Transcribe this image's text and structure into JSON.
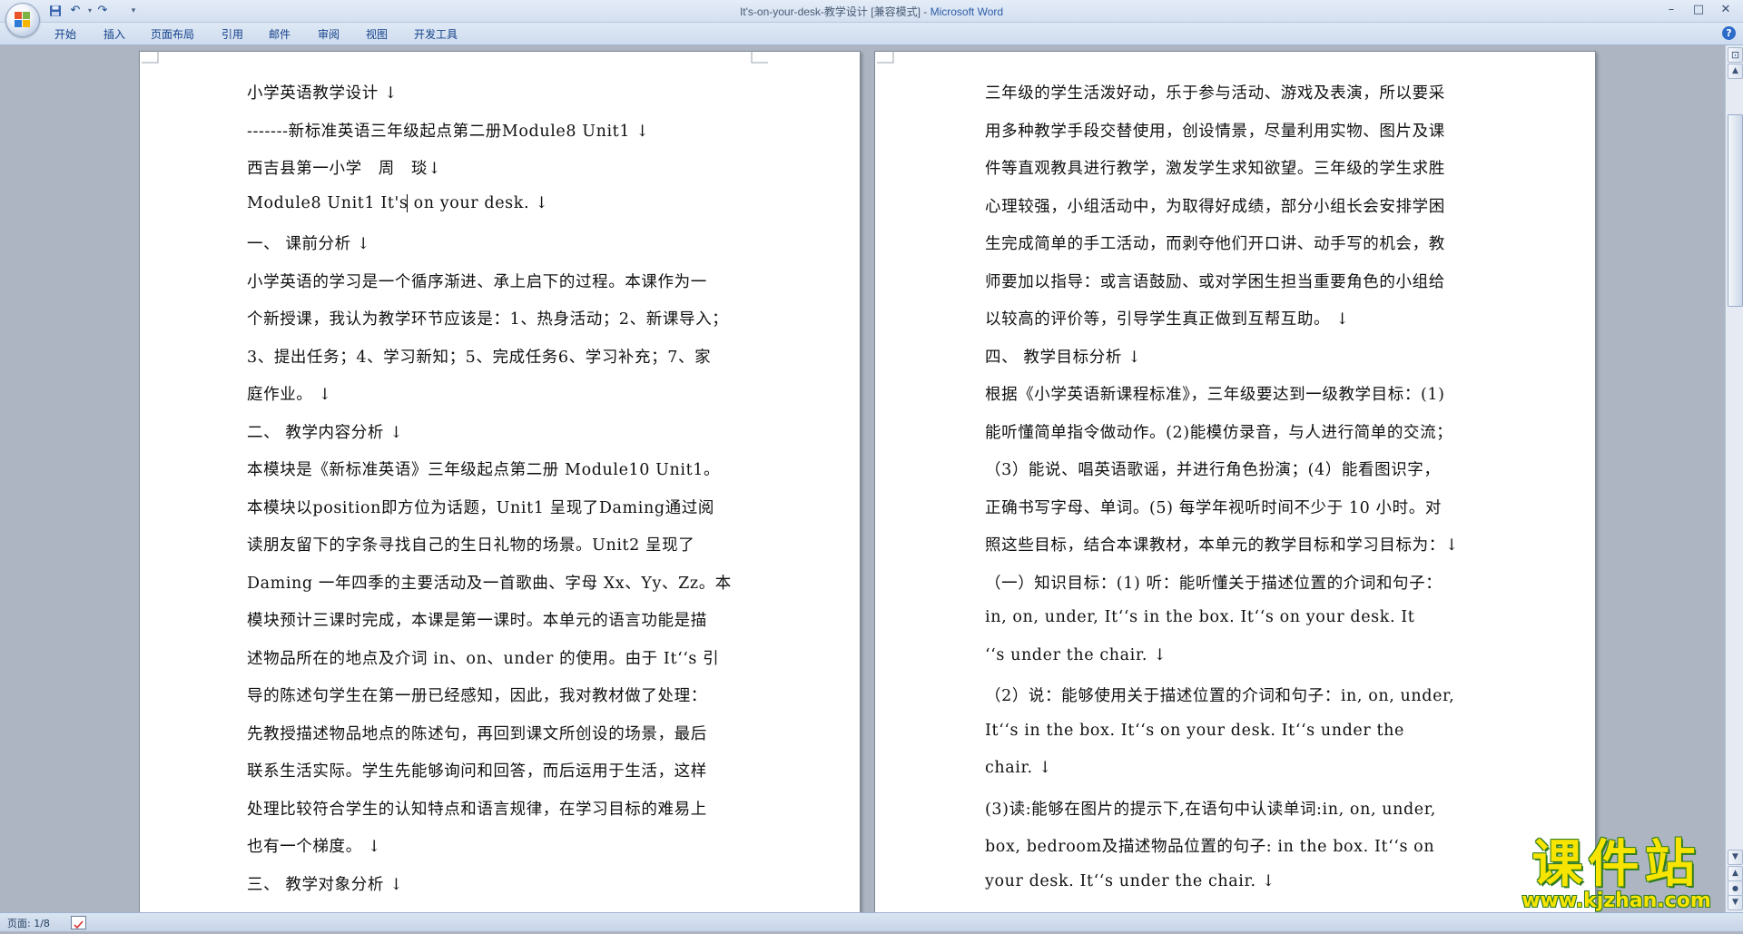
{
  "window": {
    "title_doc": "It's-on-your-desk-教学设计 [兼容模式] - ",
    "title_app": "Microsoft Word"
  },
  "quick_access": {
    "icons": [
      "save-icon",
      "undo-icon",
      "redo-icon",
      "customize-icon"
    ],
    "undo_glyph": "↶",
    "redo_glyph": "↷",
    "customize_glyph": "▾"
  },
  "window_controls": {
    "minimize": "–",
    "maximize": "□",
    "close": "✕"
  },
  "ribbon": {
    "tabs": [
      {
        "label": "开始"
      },
      {
        "label": "插入"
      },
      {
        "label": "页面布局"
      },
      {
        "label": "引用"
      },
      {
        "label": "邮件"
      },
      {
        "label": "审阅"
      },
      {
        "label": "视图"
      },
      {
        "label": "开发工具"
      }
    ],
    "help_label": "?"
  },
  "document": {
    "left_page": [
      "小学英语教学设计 ↓",
      "-------新标准英语三年级起点第二册Module8 Unit1 ↓",
      "西吉县第一小学　周　琰↓",
      "Module8 Unit1 It's on your desk. ↓",
      "一、 课前分析 ↓",
      "小学英语的学习是一个循序渐进、承上启下的过程。本课作为一",
      "个新授课，我认为教学环节应该是：1、热身活动；2、新课导入；",
      "3、提出任务；4、学习新知；5、完成任务6、学习补充；7、家",
      "庭作业。 ↓",
      "二、 教学内容分析 ↓",
      "本模块是《新标准英语》三年级起点第二册 Module10 Unit1。",
      "本模块以position即方位为话题，Unit1 呈现了Daming通过阅",
      "读朋友留下的字条寻找自己的生日礼物的场景。Unit2 呈现了",
      "Daming 一年四季的主要活动及一首歌曲、字母 Xx、Yy、Zz。本",
      "模块预计三课时完成，本课是第一课时。本单元的语言功能是描",
      "述物品所在的地点及介词 in、on、under 的使用。由于 It‘‘s 引",
      "导的陈述句学生在第一册已经感知，因此，我对教材做了处理：",
      "先教授描述物品地点的陈述句，再回到课文所创设的场景，最后",
      "联系生活实际。学生先能够询问和回答，而后运用于生活，这样",
      "处理比较符合学生的认知特点和语言规律，在学习目标的难易上",
      "也有一个梯度。 ↓",
      "三、 教学对象分析 ↓"
    ],
    "right_page": [
      "三年级的学生活泼好动，乐于参与活动、游戏及表演，所以要采",
      "用多种教学手段交替使用，创设情景，尽量利用实物、图片及课",
      "件等直观教具进行教学，激发学生求知欲望。三年级的学生求胜",
      "心理较强，小组活动中，为取得好成绩，部分小组长会安排学困",
      "生完成简单的手工活动，而剥夺他们开口讲、动手写的机会，教",
      "师要加以指导：或言语鼓励、或对学困生担当重要角色的小组给",
      "以较高的评价等，引导学生真正做到互帮互助。 ↓",
      "四、 教学目标分析 ↓",
      "根据《小学英语新课程标准》，三年级要达到一级教学目标：(1)",
      "能听懂简单指令做动作。(2)能模仿录音，与人进行简单的交流；",
      "（3）能说、唱英语歌谣，并进行角色扮演；(4）能看图识字，",
      "正确书写字母、单词。(5) 每学年视听时间不少于 10 小时。对",
      "照这些目标，结合本课教材，本单元的教学目标和学习目标为：↓",
      "（一）知识目标：(1) 听：能听懂关于描述位置的介词和句子：",
      "in, on, under, It‘‘s in the box. It‘‘s on your desk. It",
      "‘‘s under the chair. ↓",
      "（2）说：能够使用关于描述位置的介词和句子：in, on, under,",
      "It‘‘s in the box. It‘‘s on your desk. It‘‘s under the",
      "chair. ↓",
      "(3)读:能够在图片的提示下,在语句中认读单词:in, on, under,",
      "box, bedroom及描述物品位置的句子: in the box. It‘‘s on",
      "your desk. It‘‘s under the chair. ↓"
    ]
  },
  "status_bar": {
    "page_info": "页面: 1/8"
  },
  "watermark": {
    "name": "课件站",
    "url": "www.kjzhan.com"
  },
  "colors": {
    "ribbon_text": "#15428b",
    "app_name": "#2e5da8",
    "watermark_fill": "#f7e400",
    "watermark_outline": "#2f7d1f"
  }
}
